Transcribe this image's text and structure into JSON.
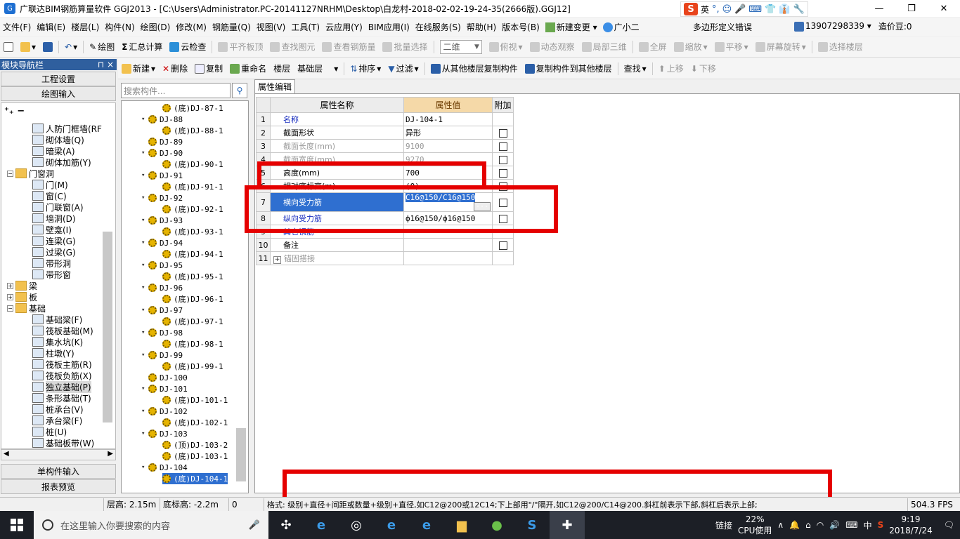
{
  "window": {
    "title": "广联达BIM钢筋算量软件 GGJ2013 - [C:\\Users\\Administrator.PC-20141127NRHM\\Desktop\\白龙村-2018-02-02-19-24-35(2666版).GGJ12]",
    "ime_label": "英"
  },
  "menu": {
    "items": [
      "文件(F)",
      "编辑(E)",
      "楼层(L)",
      "构件(N)",
      "绘图(D)",
      "修改(M)",
      "钢筋量(Q)",
      "视图(V)",
      "工具(T)",
      "云应用(Y)",
      "BIM应用(I)",
      "在线服务(S)",
      "帮助(H)",
      "版本号(B)",
      "新建变更 ▾",
      "广小二"
    ],
    "notice": "多边形定义错误",
    "phone": "13907298339 ▾",
    "beans": "造价豆:0"
  },
  "toolbar1": {
    "draw": "绘图",
    "sum": "汇总计算",
    "cloud_check": "云检查",
    "align_top": "平齐板顶",
    "find_elem": "查找图元",
    "view_rebar": "查看钢筋量",
    "batch_select": "批量选择",
    "view_mode": "二维",
    "top_view": "俯视",
    "dynamic": "动态观察",
    "local3d": "局部三维",
    "fullscreen": "全屏",
    "zoom": "缩放",
    "pan": "平移",
    "rotate": "屏幕旋转",
    "select_floor": "选择楼层"
  },
  "toolbar2": {
    "new": "新建",
    "delete": "删除",
    "copy": "复制",
    "rename": "重命名",
    "floor_label": "楼层",
    "floor_value": "基础层",
    "sort": "排序",
    "filter": "过滤",
    "copy_from": "从其他楼层复制构件",
    "copy_to": "复制构件到其他楼层",
    "find": "查找",
    "move_up": "上移",
    "move_down": "下移"
  },
  "nav": {
    "title": "模块导航栏",
    "pin": "⊓ ×",
    "project_settings": "工程设置",
    "draw_input": "绘图输入",
    "single_input": "单构件输入",
    "report_preview": "报表预览",
    "items": [
      {
        "label": "人防门框墙(RF",
        "indent": 2,
        "folder": false
      },
      {
        "label": "砌体墙(Q)",
        "indent": 2,
        "folder": false
      },
      {
        "label": "暗梁(A)",
        "indent": 2,
        "folder": false
      },
      {
        "label": "砌体加筋(Y)",
        "indent": 2,
        "folder": false
      },
      {
        "label": "门窗洞",
        "indent": 1,
        "folder": true,
        "exp": "−"
      },
      {
        "label": "门(M)",
        "indent": 2,
        "folder": false
      },
      {
        "label": "窗(C)",
        "indent": 2,
        "folder": false
      },
      {
        "label": "门联窗(A)",
        "indent": 2,
        "folder": false
      },
      {
        "label": "墙洞(D)",
        "indent": 2,
        "folder": false
      },
      {
        "label": "壁龛(I)",
        "indent": 2,
        "folder": false
      },
      {
        "label": "连梁(G)",
        "indent": 2,
        "folder": false
      },
      {
        "label": "过梁(G)",
        "indent": 2,
        "folder": false
      },
      {
        "label": "带形洞",
        "indent": 2,
        "folder": false
      },
      {
        "label": "带形窗",
        "indent": 2,
        "folder": false
      },
      {
        "label": "梁",
        "indent": 1,
        "folder": true,
        "exp": "+"
      },
      {
        "label": "板",
        "indent": 1,
        "folder": true,
        "exp": "+"
      },
      {
        "label": "基础",
        "indent": 1,
        "folder": true,
        "exp": "−"
      },
      {
        "label": "基础梁(F)",
        "indent": 2,
        "folder": false
      },
      {
        "label": "筏板基础(M)",
        "indent": 2,
        "folder": false
      },
      {
        "label": "集水坑(K)",
        "indent": 2,
        "folder": false
      },
      {
        "label": "柱墩(Y)",
        "indent": 2,
        "folder": false
      },
      {
        "label": "筏板主筋(R)",
        "indent": 2,
        "folder": false
      },
      {
        "label": "筏板负筋(X)",
        "indent": 2,
        "folder": false
      },
      {
        "label": "独立基础(P)",
        "indent": 2,
        "folder": false,
        "selected": true
      },
      {
        "label": "条形基础(T)",
        "indent": 2,
        "folder": false
      },
      {
        "label": "桩承台(V)",
        "indent": 2,
        "folder": false
      },
      {
        "label": "承台梁(F)",
        "indent": 2,
        "folder": false
      },
      {
        "label": "桩(U)",
        "indent": 2,
        "folder": false
      },
      {
        "label": "基础板带(W)",
        "indent": 2,
        "folder": false
      }
    ]
  },
  "components": {
    "search_placeholder": "搜索构件...",
    "items": [
      {
        "label": "(底)DJ-87-1",
        "level": 1
      },
      {
        "label": "DJ-88",
        "level": 0,
        "exp": "▾"
      },
      {
        "label": "(底)DJ-88-1",
        "level": 1
      },
      {
        "label": "DJ-89",
        "level": 0
      },
      {
        "label": "DJ-90",
        "level": 0,
        "exp": "▾"
      },
      {
        "label": "(底)DJ-90-1",
        "level": 1
      },
      {
        "label": "DJ-91",
        "level": 0,
        "exp": "▾"
      },
      {
        "label": "(底)DJ-91-1",
        "level": 1
      },
      {
        "label": "DJ-92",
        "level": 0,
        "exp": "▾"
      },
      {
        "label": "(底)DJ-92-1",
        "level": 1
      },
      {
        "label": "DJ-93",
        "level": 0,
        "exp": "▾"
      },
      {
        "label": "(底)DJ-93-1",
        "level": 1
      },
      {
        "label": "DJ-94",
        "level": 0,
        "exp": "▾"
      },
      {
        "label": "(底)DJ-94-1",
        "level": 1
      },
      {
        "label": "DJ-95",
        "level": 0,
        "exp": "▾"
      },
      {
        "label": "(底)DJ-95-1",
        "level": 1
      },
      {
        "label": "DJ-96",
        "level": 0,
        "exp": "▾"
      },
      {
        "label": "(底)DJ-96-1",
        "level": 1
      },
      {
        "label": "DJ-97",
        "level": 0,
        "exp": "▾"
      },
      {
        "label": "(底)DJ-97-1",
        "level": 1
      },
      {
        "label": "DJ-98",
        "level": 0,
        "exp": "▾"
      },
      {
        "label": "(底)DJ-98-1",
        "level": 1
      },
      {
        "label": "DJ-99",
        "level": 0,
        "exp": "▾"
      },
      {
        "label": "(底)DJ-99-1",
        "level": 1
      },
      {
        "label": "DJ-100",
        "level": 0
      },
      {
        "label": "DJ-101",
        "level": 0,
        "exp": "▾"
      },
      {
        "label": "(底)DJ-101-1",
        "level": 1
      },
      {
        "label": "DJ-102",
        "level": 0,
        "exp": "▾"
      },
      {
        "label": "(底)DJ-102-1",
        "level": 1
      },
      {
        "label": "DJ-103",
        "level": 0,
        "exp": "▾"
      },
      {
        "label": "(顶)DJ-103-2",
        "level": 1
      },
      {
        "label": "(底)DJ-103-1",
        "level": 1
      },
      {
        "label": "DJ-104",
        "level": 0,
        "exp": "▾"
      },
      {
        "label": "(底)DJ-104-1",
        "level": 1,
        "selected": true
      }
    ]
  },
  "properties": {
    "tab": "属性编辑",
    "header": {
      "name": "属性名称",
      "value": "属性值",
      "extra": "附加"
    },
    "rows": [
      {
        "n": "1",
        "name": "名称",
        "value": "DJ-104-1",
        "style": "blue",
        "check": false
      },
      {
        "n": "2",
        "name": "截面形状",
        "value": "异形",
        "style": "",
        "check": true
      },
      {
        "n": "3",
        "name": "截面长度(mm)",
        "value": "9100",
        "style": "gray",
        "check": true
      },
      {
        "n": "4",
        "name": "截面宽度(mm)",
        "value": "9270",
        "style": "gray",
        "check": true
      },
      {
        "n": "5",
        "name": "高度(mm)",
        "value": "700",
        "style": "",
        "check": true
      },
      {
        "n": "6",
        "name": "相对底标高(m)",
        "value": "(0)",
        "style": "",
        "check": true
      },
      {
        "n": "7",
        "name": "横向受力筋",
        "value": "C16@150/C16@150",
        "style": "blue",
        "check": true,
        "selected": true
      },
      {
        "n": "8",
        "name": "纵向受力筋",
        "value": "ф16@150/ф16@150",
        "style": "blue",
        "check": true
      },
      {
        "n": "9",
        "name": "其它钢筋",
        "value": "",
        "style": "blue",
        "check": false
      },
      {
        "n": "10",
        "name": "备注",
        "value": "",
        "style": "",
        "check": true
      },
      {
        "n": "11",
        "name": "锚固搭接",
        "value": "",
        "style": "gray",
        "check": false,
        "expand": "+"
      }
    ]
  },
  "status": {
    "floor_height": "层高: 2.15m",
    "bottom_elev": "底标高: -2.2m",
    "zero": "0",
    "format_hint": "格式: 级别+直径+间距或数量+级别+直径,如C12@200或12C14;下上部用\"/\"隔开,如C12@200/C14@200.斜杠前表示下部,斜杠后表示上部;",
    "fps": "504.3 FPS"
  },
  "taskbar": {
    "search_placeholder": "在这里输入你要搜索的内容",
    "link_label": "链接",
    "cpu_value": "22%",
    "cpu_label": "CPU使用",
    "lang": "中",
    "time": "9:19",
    "date": "2018/7/24"
  }
}
